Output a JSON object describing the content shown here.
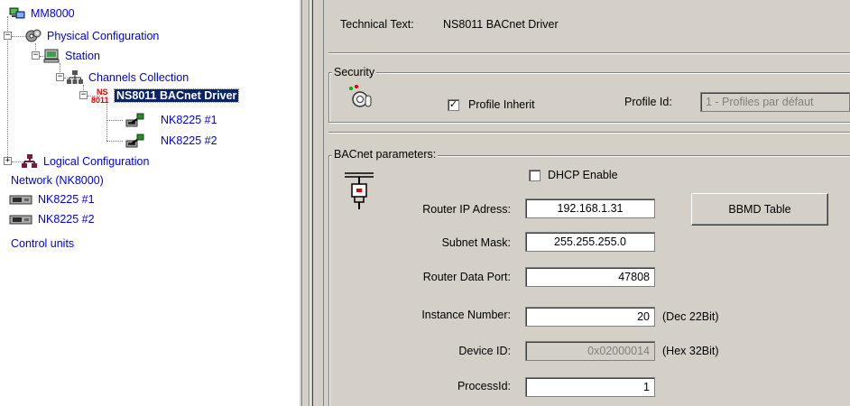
{
  "tree": {
    "root": "MM8000",
    "physical": "Physical Configuration",
    "station": "Station",
    "channels": "Channels Collection",
    "driver_badge_top": "NS",
    "driver_badge_bottom": "8011",
    "driver": "NS8011 BACnet Driver",
    "nk1": "NK8225 #1",
    "nk2": "NK8225 #2",
    "logical": "Logical Configuration",
    "network": "Network (NK8000)",
    "unit1": "NK8225 #1",
    "unit2": "NK8225 #2",
    "control": "Control units"
  },
  "details": {
    "technical_label": "Technical Text:",
    "technical_value": "NS8011 BACnet Driver",
    "security": {
      "title": "Security",
      "profile_inherit_label": "Profile Inherit",
      "profile_inherit_checked": true,
      "profile_id_label": "Profile Id:",
      "profile_id_value": "1 - Profiles par défaut"
    },
    "bacnet": {
      "title": "BACnet parameters:",
      "dhcp_label": "DHCP Enable",
      "dhcp_checked": false,
      "router_ip_label": "Router IP Adress:",
      "router_ip_value": "192.168.1.31",
      "subnet_label": "Subnet Mask:",
      "subnet_value": "255.255.255.0",
      "port_label": "Router Data Port:",
      "port_value": "47808",
      "instance_label": "Instance Number:",
      "instance_value": "20",
      "instance_hint": "(Dec 22Bit)",
      "device_label": "Device ID:",
      "device_value": "0x02000014",
      "device_hint": "(Hex 32Bit)",
      "process_label": "ProcessId:",
      "process_value": "1",
      "bbmd_button": "BBMD Table"
    }
  }
}
